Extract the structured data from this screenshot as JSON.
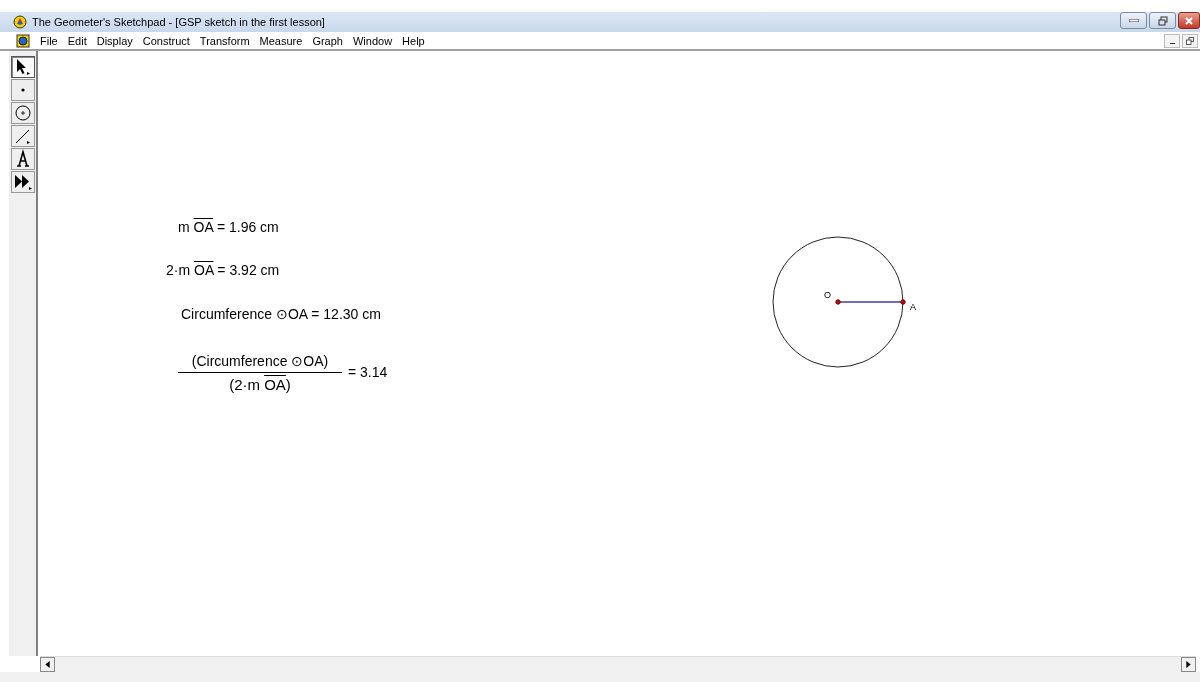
{
  "window": {
    "title": "The Geometer's Sketchpad - [GSP sketch in the first lesson]"
  },
  "menu": [
    "File",
    "Edit",
    "Display",
    "Construct",
    "Transform",
    "Measure",
    "Graph",
    "Window",
    "Help"
  ],
  "tools": [
    {
      "kind": "arrow",
      "selected": true
    },
    {
      "kind": "point",
      "selected": false
    },
    {
      "kind": "compass",
      "selected": false
    },
    {
      "kind": "segment",
      "selected": false
    },
    {
      "kind": "text",
      "selected": false
    },
    {
      "kind": "custom",
      "selected": false
    }
  ],
  "measurements": [
    {
      "parts": [
        {
          "text": "m "
        },
        {
          "text": "OA",
          "overline": true
        },
        {
          "text": " = 1.96 cm"
        }
      ]
    },
    {
      "parts": [
        {
          "text": "2·m "
        },
        {
          "text": "OA",
          "overline": true
        },
        {
          "text": " = 3.92 cm"
        }
      ]
    },
    {
      "parts": [
        {
          "text": "Circumference ⊙OA = 12.30 cm"
        }
      ]
    }
  ],
  "calculation": {
    "numerator": [
      {
        "text": "(Circumference ⊙OA)"
      }
    ],
    "denominator": [
      {
        "text": "(2·m "
      },
      {
        "text": "OA",
        "overline": true
      },
      {
        "text": ")"
      }
    ],
    "result": "= 3.14"
  },
  "points": [
    {
      "label": "O"
    },
    {
      "label": "A"
    }
  ]
}
